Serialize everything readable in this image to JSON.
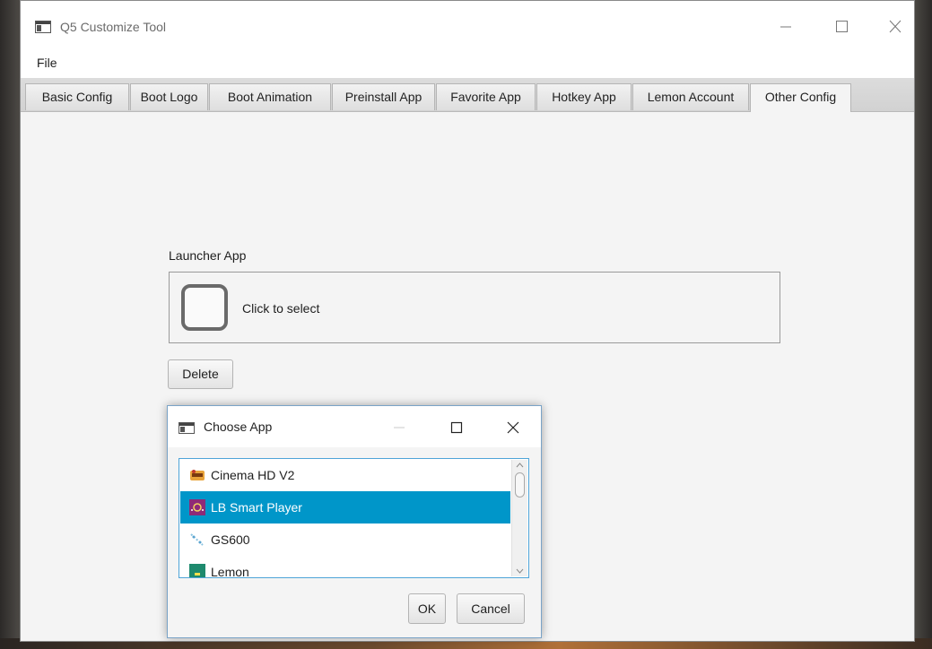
{
  "window": {
    "title": "Q5 Customize Tool",
    "icon": "app-window-icon",
    "controls": [
      "minimize-icon",
      "maximize-icon",
      "close-icon"
    ]
  },
  "menu": {
    "file": "File"
  },
  "tabs": [
    {
      "label": "Basic Config"
    },
    {
      "label": "Boot Logo"
    },
    {
      "label": "Boot Animation"
    },
    {
      "label": "Preinstall App"
    },
    {
      "label": "Favorite App"
    },
    {
      "label": "Hotkey App"
    },
    {
      "label": "Lemon Account"
    },
    {
      "label": "Other Config"
    }
  ],
  "active_tab": "Other Config",
  "content": {
    "launcher_label": "Launcher App",
    "click_to_select": "Click to select",
    "delete_label": "Delete"
  },
  "dialog": {
    "title": "Choose App",
    "apps": [
      {
        "label": "Cinema HD V2",
        "icon": "cinema-hd-icon"
      },
      {
        "label": "LB Smart Player",
        "icon": "lb-smart-player-icon",
        "selected": true
      },
      {
        "label": "GS600",
        "icon": "gs600-icon"
      },
      {
        "label": "Lemon",
        "icon": "lemon-app-icon"
      }
    ],
    "ok_label": "OK",
    "cancel_label": "Cancel"
  },
  "colors": {
    "selection": "#0096c9",
    "list_border": "#4ea4d8",
    "window_bg": "#f4f4f4"
  }
}
